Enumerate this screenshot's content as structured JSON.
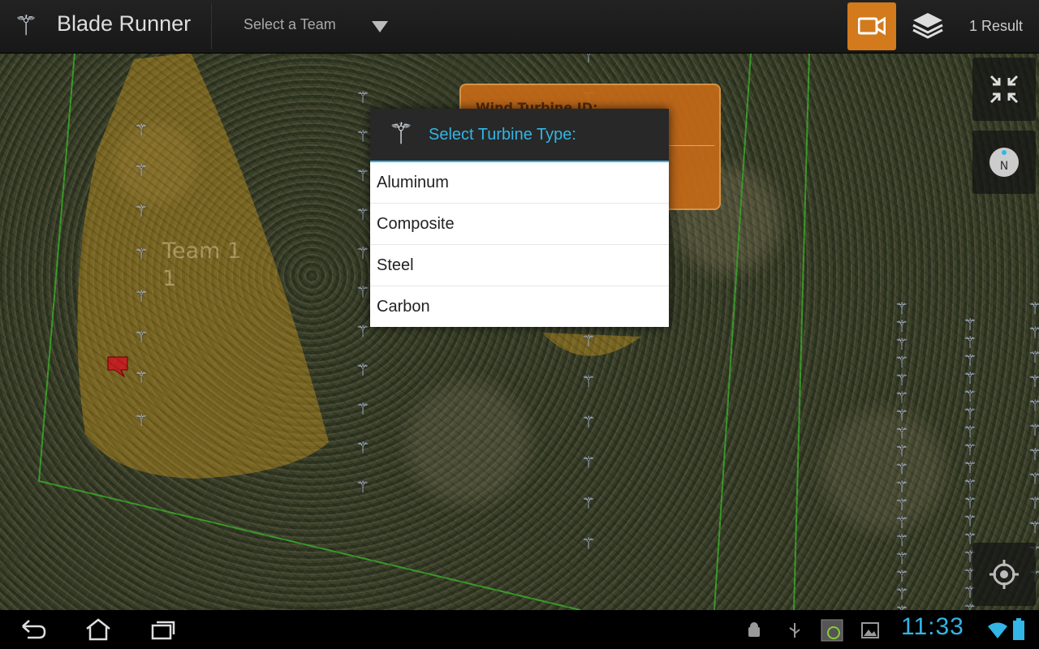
{
  "app": {
    "title": "Blade Runner",
    "icon": "wind-turbine-icon"
  },
  "actionbar": {
    "team_select": "Select a Team",
    "video_icon": "video-camera-icon",
    "layers_icon": "layers-icon",
    "result_count": "1 Result"
  },
  "map": {
    "team_label_line1": "Team 1",
    "team_label_line2": "1",
    "turbine_glyph": "⚚",
    "colors": {
      "team_zone": "#c8961e",
      "boundary": "#3a9a2a",
      "marker": "#c02020"
    },
    "popup_label": "Wind Turbine ID:"
  },
  "dialog": {
    "title": "Select Turbine Type:",
    "icon": "wind-turbine-icon",
    "options": [
      "Aluminum",
      "Composite",
      "Steel",
      "Carbon"
    ]
  },
  "system": {
    "clock": "11:33",
    "icons": [
      "back-icon",
      "home-icon",
      "recent-apps-icon",
      "android-debug-icon",
      "usb-icon",
      "screenshot-icon",
      "gallery-icon",
      "wifi-icon",
      "battery-icon"
    ]
  },
  "colors": {
    "accent": "#33b5e5",
    "orange": "#d27a1c"
  }
}
